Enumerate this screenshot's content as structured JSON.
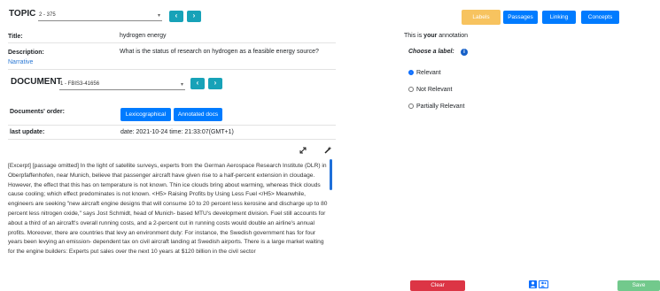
{
  "topic": {
    "label": "TOPIC",
    "selected": "2 - 375",
    "title_label": "Title:",
    "title_value": "hydrogen energy",
    "description_label": "Description:",
    "description_value": "What is the status of research on hydrogen as a feasible energy source?",
    "narrative_link": "Narrative"
  },
  "document": {
    "label": "DOCUMENT",
    "selected": "1 - FBIS3-41656",
    "order_label": "Documents' order:",
    "order_buttons": [
      "Lexicographical",
      "Annotated docs"
    ],
    "update_label": "last update:",
    "update_value": "date: 2021-10-24 time: 21:33:07(GMT+1)",
    "text": "[Excerpt] [passage omitted] In the light of satellite surveys, experts from the German Aerospace Research Institute (DLR) in Oberpfaffenhofen, near Munich, believe that passenger aircraft have given rise to a half-percent extension in cloudage. However, the effect that this has on temperature is not known. Thin ice clouds bring about warming, whereas thick clouds cause cooling; which effect predominates is not known. <H5> Raising Profits by Using Less Fuel </H5> Meanwhile, engineers are seeking \"new aircraft engine designs that will consume 10 to 20 percent less kerosine and discharge up to 80 percent less nitrogen oxide,\" says Jost Schmidt, head of Munich- based MTU's development division. Fuel still accounts for about a third of an aircraft's overall running costs, and a 2-percent cut in running costs would double an airline's annual profits. Moreover, there are countries that levy an environment duty: For instance, the Swedish government has for four years been levying an emission- dependent tax on civil aircraft landing at Swedish airports. There is a large market waiting for the engine builders: Experts put sales over the next 10 years at $120 billion in the civil sector"
  },
  "nav": {
    "prev_symbol": "‹",
    "next_symbol": "›"
  },
  "top_buttons": {
    "labels": "Labels",
    "passages": "Passages",
    "linking": "Linking",
    "concepts": "Concepts"
  },
  "annotation": {
    "intro_pre": "This is ",
    "intro_bold": "your",
    "intro_post": " annotation",
    "choose_label": "Choose a label:",
    "info_symbol": "i",
    "options": [
      "Relevant",
      "Not Relevant",
      "Partially Relevant"
    ],
    "selected_option": "Relevant"
  },
  "bottom": {
    "clear": "Clear",
    "save": "Save"
  },
  "icons": {
    "expand": "expand-icon",
    "magic": "magic-wand-icon",
    "user": "user-icon",
    "users": "users-icon"
  },
  "colors": {
    "primary": "#007bff",
    "info": "#17a2b8",
    "warning": "#f7c35f",
    "danger": "#dc3545",
    "success": "#72c98c",
    "link": "#2a78d4"
  }
}
